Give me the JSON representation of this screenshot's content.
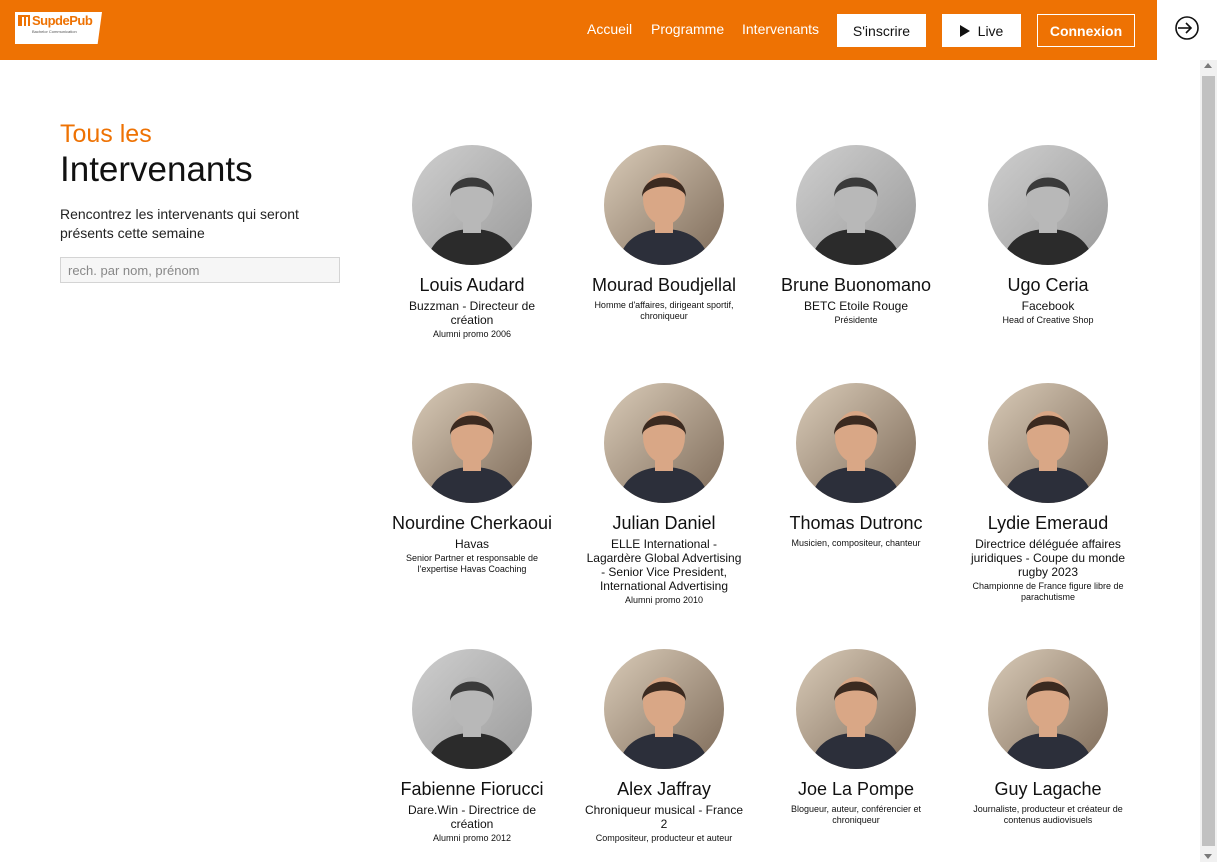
{
  "brand": {
    "logo_text": "SupdePub",
    "logo_sub": "Bachelor Communication",
    "accent": "#ee7203"
  },
  "nav": {
    "links": [
      "Accueil",
      "Programme",
      "Intervenants"
    ],
    "signup": "S'inscrire",
    "live": "Live",
    "login": "Connexion"
  },
  "page": {
    "kicker": "Tous les",
    "title": "Intervenants",
    "intro": "Rencontrez les intervenants qui seront présents cette semaine",
    "search_placeholder": "rech. par nom, prénom"
  },
  "speakers": [
    {
      "name": "Louis Audard",
      "role": "Buzzman - Directeur de création",
      "detail": "Alumni promo 2006",
      "photo": "portrait-bw"
    },
    {
      "name": "Mourad Boudjellal",
      "role": "",
      "detail": "Homme d'affaires, dirigeant sportif, chroniqueur",
      "photo": "portrait-color"
    },
    {
      "name": "Brune Buonomano",
      "role": "BETC Etoile Rouge",
      "detail": "Présidente",
      "photo": "portrait-bw"
    },
    {
      "name": "Ugo Ceria",
      "role": "Facebook",
      "detail": "Head of Creative Shop",
      "photo": "portrait-bw"
    },
    {
      "name": "Nourdine Cherkaoui",
      "role": "Havas",
      "detail": "Senior Partner et responsable de l'expertise Havas Coaching",
      "photo": "portrait-color"
    },
    {
      "name": "Julian Daniel",
      "role": "ELLE International - Lagardère Global Advertising - Senior Vice President, International Advertising",
      "detail": "Alumni promo 2010",
      "photo": "portrait-color"
    },
    {
      "name": "Thomas Dutronc",
      "role": "",
      "detail": "Musicien, compositeur, chanteur",
      "photo": "portrait-color"
    },
    {
      "name": "Lydie Emeraud",
      "role": "Directrice déléguée affaires juridiques - Coupe du monde rugby 2023",
      "detail": "Championne de France figure libre de parachutisme",
      "photo": "portrait-color"
    },
    {
      "name": "Fabienne Fiorucci",
      "role": "Dare.Win - Directrice de création",
      "detail": "Alumni promo 2012",
      "photo": "portrait-bw"
    },
    {
      "name": "Alex Jaffray",
      "role": "Chroniqueur musical - France 2",
      "detail": "Compositeur, producteur et auteur",
      "photo": "portrait-color"
    },
    {
      "name": "Joe La Pompe",
      "role": "",
      "detail": "Blogueur, auteur, conférencier et chroniqueur",
      "photo": "portrait-color"
    },
    {
      "name": "Guy Lagache",
      "role": "",
      "detail": "Journaliste, producteur et créateur de contenus audiovisuels",
      "photo": "portrait-color"
    }
  ]
}
